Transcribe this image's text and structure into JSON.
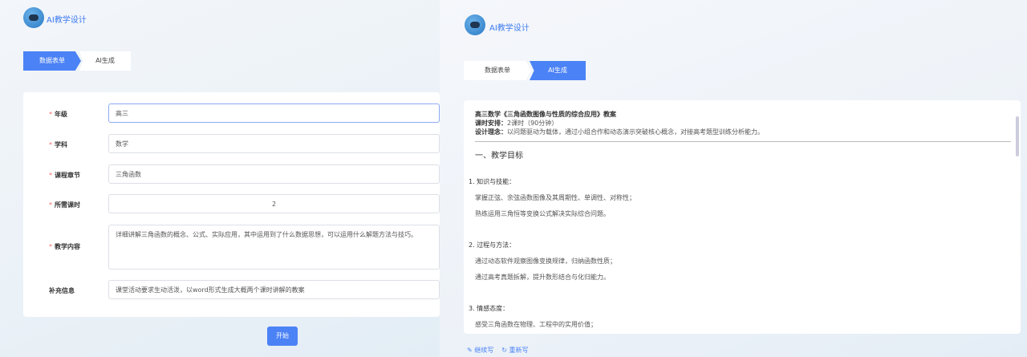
{
  "app": {
    "title": "AI教学设计"
  },
  "tabs": [
    {
      "label": "数据表单"
    },
    {
      "label": "AI生成"
    }
  ],
  "form": {
    "fields": [
      {
        "label": "年级",
        "required": true,
        "value": "高三"
      },
      {
        "label": "学科",
        "required": true,
        "value": "数学"
      },
      {
        "label": "课程章节",
        "required": true,
        "value": "三角函数"
      },
      {
        "label": "所需课时",
        "required": true,
        "value": "2"
      },
      {
        "label": "教学内容",
        "required": true,
        "value": "详细讲解三角函数的概念、公式、实际应用，其中运用到了什么数据思想，可以运用什么解题方法与技巧。"
      },
      {
        "label": "补充信息",
        "required": false,
        "value": "课堂活动要求生动活泼，以word形式生成大概两个课时讲解的教案"
      }
    ],
    "start_label": "开始"
  },
  "result": {
    "title": "高三数学《三角函数图像与性质的综合应用》教案",
    "schedule_label": "课时安排：",
    "schedule": "2课时（90分钟）",
    "concept_label": "设计理念：",
    "concept": "以问题驱动为载体，通过小组合作和动态演示突破核心概念，对接高考题型训练分析能力。",
    "section1": "一、教学目标",
    "items": [
      {
        "heading": "1. 知识与技能：",
        "lines": [
          "掌握正弦、余弦函数图像及其周期性、单调性、对称性；",
          "熟练运用三角恒等变换公式解决实际综合问题。"
        ]
      },
      {
        "heading": "2. 过程与方法：",
        "lines": [
          "通过动态软件观察图像变换规律，归纳函数性质；",
          "通过高考真题拆解，提升数形结合与化归能力。"
        ]
      },
      {
        "heading": "3. 情感态度：",
        "lines": [
          "感受三角函数在物理、工程中的实用价值；"
        ]
      }
    ],
    "continue_label": "继续写",
    "rewrite_label": "重新写"
  },
  "colors": {
    "accent": "#4b82f5",
    "required": "#f56c6c"
  }
}
